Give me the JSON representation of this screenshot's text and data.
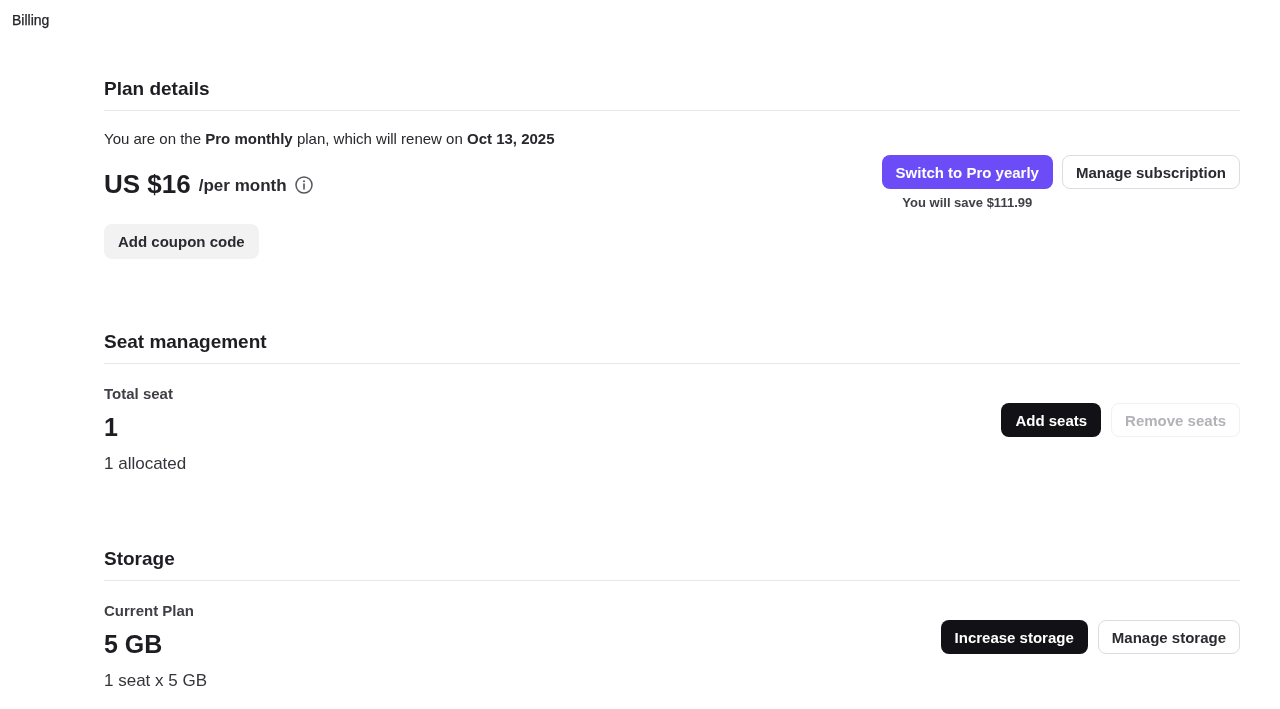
{
  "page_title": "Billing",
  "sections": [
    {
      "kind": "plan",
      "heading": "Plan details",
      "summary": "You are on the **Pro monthly** plan, which will renew on **Oct 13, 2025**",
      "price": "US $16",
      "period": "/per month",
      "coupon_button": {
        "label": "Add coupon code",
        "kind": "soft",
        "disabled": false
      },
      "actions": [
        {
          "label": "Switch to Pro yearly",
          "kind": "accent",
          "disabled": false,
          "note": "You will save **$111.99**"
        },
        {
          "label": "Manage subscription",
          "kind": "outline",
          "disabled": false
        }
      ]
    },
    {
      "kind": "stat",
      "heading": "Seat management",
      "label": "Total seat",
      "value": "1",
      "detail": "1 allocated",
      "actions": [
        {
          "label": "Add seats",
          "kind": "dark",
          "disabled": false
        },
        {
          "label": "Remove seats",
          "kind": "outline",
          "disabled": true
        }
      ]
    },
    {
      "kind": "stat",
      "heading": "Storage",
      "label": "Current Plan",
      "value": "5 GB",
      "detail": "1 seat x 5 GB",
      "actions": [
        {
          "label": "Increase storage",
          "kind": "dark",
          "disabled": false
        },
        {
          "label": "Manage storage",
          "kind": "outline",
          "disabled": false
        }
      ]
    }
  ]
}
